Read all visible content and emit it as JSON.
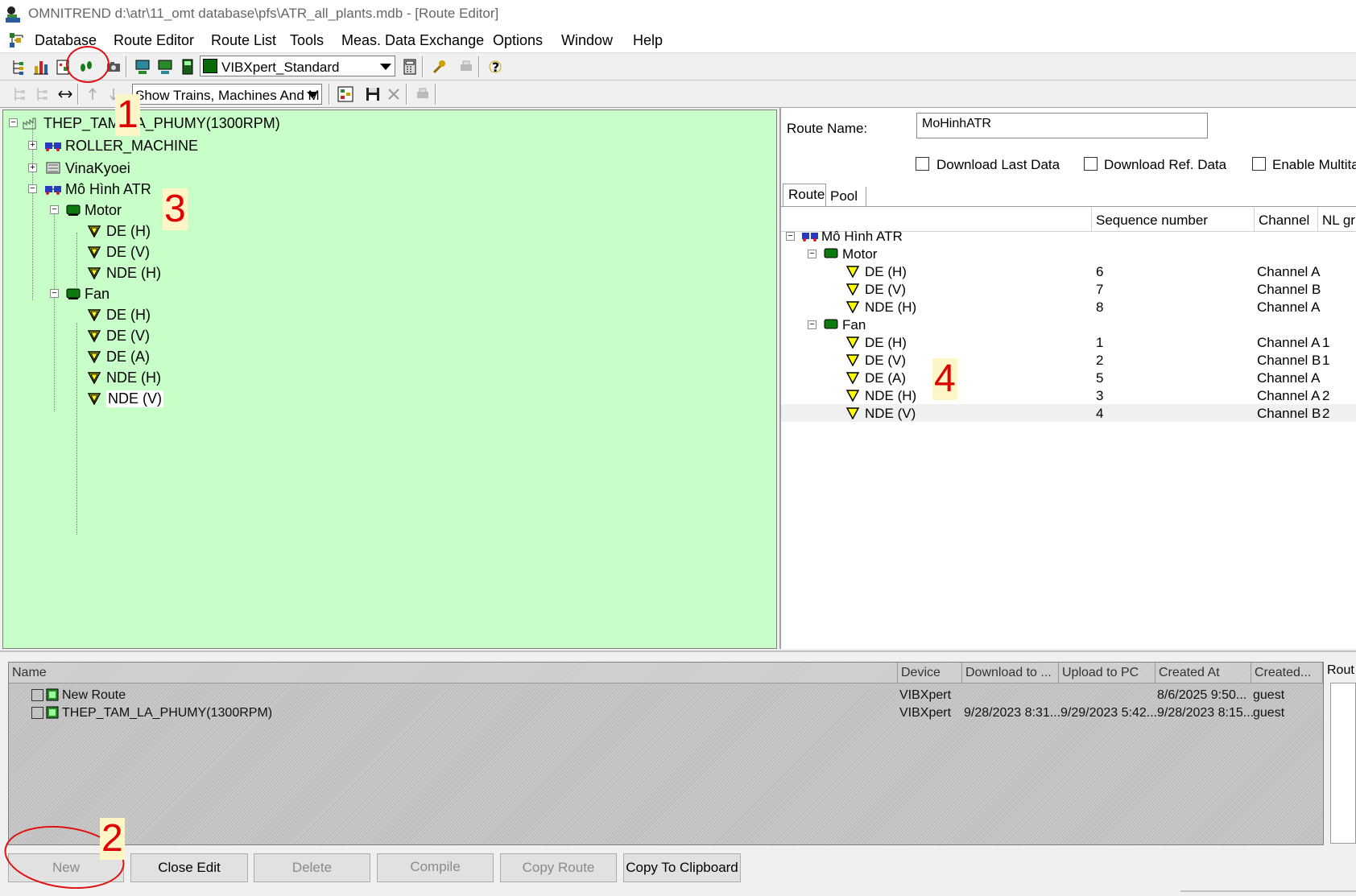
{
  "window": {
    "title": "OMNITREND d:\\atr\\11_omt database\\pfs\\ATR_all_plants.mdb - [Route Editor]"
  },
  "menu": {
    "items": [
      {
        "label": "Database",
        "accel": "D"
      },
      {
        "label": "Route Editor",
        "accel": "E"
      },
      {
        "label": "Route List",
        "accel": "L"
      },
      {
        "label": "Tools",
        "accel": "T"
      },
      {
        "label": "Meas. Data Exchange",
        "accel": "x"
      },
      {
        "label": "Options",
        "accel": "O"
      },
      {
        "label": "Window",
        "accel": "W"
      },
      {
        "label": "Help",
        "accel": "H"
      }
    ]
  },
  "toolbar": {
    "device_combo": "VIBXpert_Standard",
    "filter_combo": "Show Trains, Machines And M"
  },
  "tree": {
    "root": "THEP_TAM_LA_PHUMY(1300RPM)",
    "nodes": [
      {
        "label": "ROLLER_MACHINE"
      },
      {
        "label": "VinaKyoei"
      },
      {
        "label": "Mô Hình ATR"
      },
      {
        "label": "Motor"
      },
      {
        "label": "DE (H)"
      },
      {
        "label": "DE (V)"
      },
      {
        "label": "NDE (H)"
      },
      {
        "label": "Fan"
      },
      {
        "label": "DE (H)"
      },
      {
        "label": "DE (V)"
      },
      {
        "label": "DE (A)"
      },
      {
        "label": "NDE (H)"
      },
      {
        "label": "NDE (V)"
      }
    ]
  },
  "route_editor": {
    "route_name_label": "Route Name:",
    "route_name_value": "MoHinhATR",
    "options": [
      {
        "label": "Download Last Data",
        "checked": false
      },
      {
        "label": "Download Ref. Data",
        "checked": false
      },
      {
        "label": "Enable Multitas",
        "checked": false
      }
    ],
    "tabs": [
      "Route",
      "Pool"
    ],
    "columns": [
      "Sequence number",
      "Channel",
      "NL gr"
    ],
    "root": "Mô Hình ATR",
    "groups": [
      {
        "name": "Motor",
        "points": [
          {
            "name": "DE (H)",
            "seq": "6",
            "channel": "Channel A",
            "nl": ""
          },
          {
            "name": "DE (V)",
            "seq": "7",
            "channel": "Channel B",
            "nl": ""
          },
          {
            "name": "NDE (H)",
            "seq": "8",
            "channel": "Channel A",
            "nl": ""
          }
        ]
      },
      {
        "name": "Fan",
        "points": [
          {
            "name": "DE (H)",
            "seq": "1",
            "channel": "Channel A",
            "nl": "1"
          },
          {
            "name": "DE (V)",
            "seq": "2",
            "channel": "Channel B",
            "nl": "1"
          },
          {
            "name": "DE (A)",
            "seq": "5",
            "channel": "Channel A",
            "nl": ""
          },
          {
            "name": "NDE (H)",
            "seq": "3",
            "channel": "Channel A",
            "nl": "2"
          },
          {
            "name": "NDE (V)",
            "seq": "4",
            "channel": "Channel B",
            "nl": "2"
          }
        ]
      }
    ]
  },
  "route_list": {
    "columns": [
      "Name",
      "Device",
      "Download to ...",
      "Upload to PC",
      "Created At",
      "Created..."
    ],
    "rows": [
      {
        "name": "New Route",
        "device": "VIBXpert",
        "download": "",
        "upload": "",
        "created_at": "8/6/2025 9:50...",
        "created_by": "guest"
      },
      {
        "name": "THEP_TAM_LA_PHUMY(1300RPM)",
        "device": "VIBXpert",
        "download": "9/28/2023 8:31...",
        "upload": "9/29/2023 5:42...",
        "created_at": "9/28/2023 8:15...",
        "created_by": "guest"
      }
    ],
    "side_label": "Rout"
  },
  "buttons": {
    "new": "New",
    "close_edit": "Close Edit",
    "delete": "Delete",
    "compile": "Compile",
    "copy_route": "Copy Route",
    "copy_clipboard": "Copy To Clipboard"
  },
  "annotations": [
    "1",
    "2",
    "3",
    "4"
  ],
  "colors": {
    "tree_background": "#c8fec8",
    "annotation_red": "#e00000",
    "point_icon_yellow": "#ffff00",
    "machine_green": "#0c7a0c"
  }
}
